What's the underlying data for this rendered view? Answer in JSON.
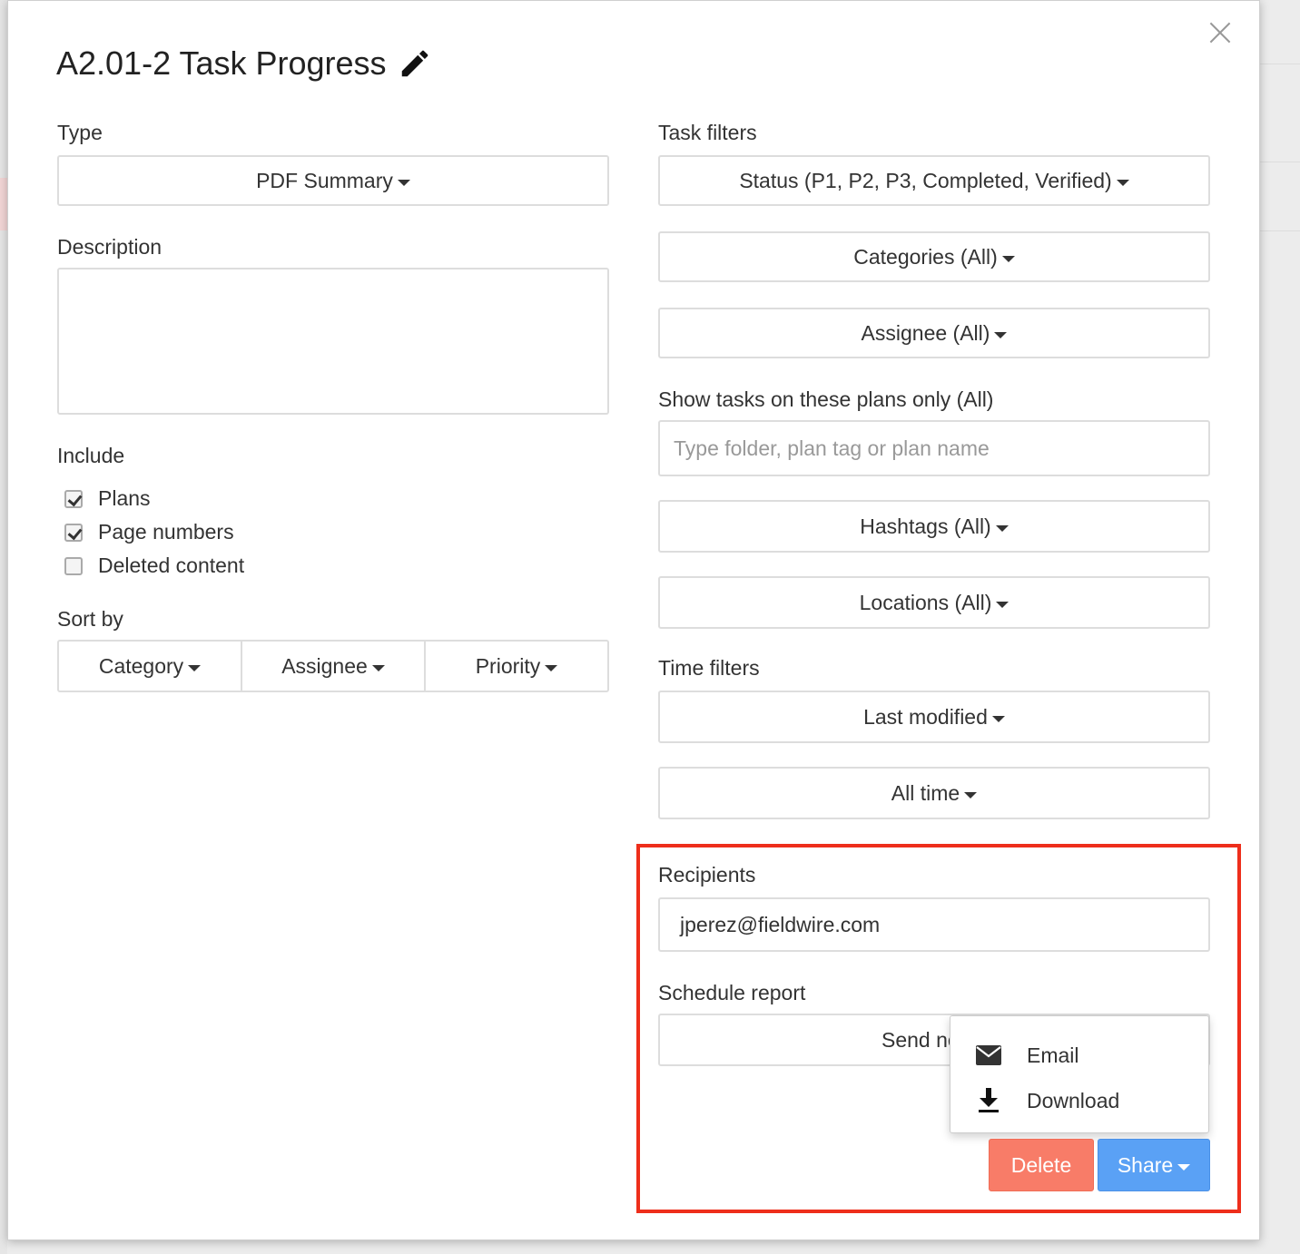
{
  "title": "A2.01-2 Task Progress",
  "left": {
    "type_label": "Type",
    "type_value": "PDF Summary",
    "description_label": "Description",
    "include_label": "Include",
    "include_options": [
      {
        "label": "Plans",
        "checked": true
      },
      {
        "label": "Page numbers",
        "checked": true
      },
      {
        "label": "Deleted content",
        "checked": false
      }
    ],
    "sort_label": "Sort by",
    "sort_options": [
      "Category",
      "Assignee",
      "Priority"
    ]
  },
  "right": {
    "task_filters_label": "Task filters",
    "status_filter": "Status (P1, P2, P3, Completed, Verified)",
    "categories_filter": "Categories (All)",
    "assignee_filter": "Assignee (All)",
    "plans_label": "Show tasks on these plans only (All)",
    "plans_placeholder": "Type folder, plan tag or plan name",
    "hashtags_filter": "Hashtags (All)",
    "locations_filter": "Locations (All)",
    "time_filters_label": "Time filters",
    "time_field": "Last modified",
    "time_range": "All time",
    "recipients_label": "Recipients",
    "recipients_value": "jperez@fieldwire.com",
    "schedule_label": "Schedule report",
    "schedule_value": "Send no"
  },
  "share_menu": {
    "items": [
      {
        "label": "Email",
        "icon": "envelope-icon"
      },
      {
        "label": "Download",
        "icon": "download-icon"
      }
    ]
  },
  "actions": {
    "delete_label": "Delete",
    "share_label": "Share"
  },
  "colors": {
    "highlight": "#ee2e1b",
    "delete": "#f87c68",
    "share": "#5aa1f5"
  }
}
